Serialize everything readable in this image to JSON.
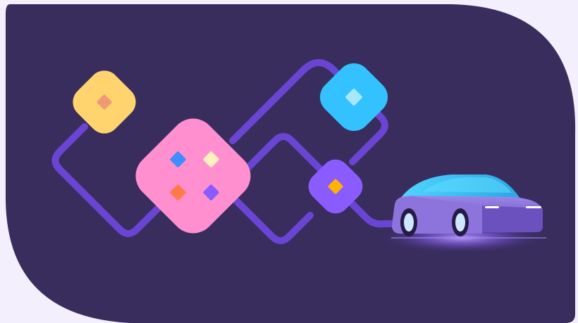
{
  "illustration": {
    "colors": {
      "page_background": "#f3effc",
      "panel_background": "#382d5d",
      "connector_path": "#6a45d4",
      "yellow_tile": "#ffd36d",
      "pink_tile": "#ff8fcf",
      "blue_tile": "#33c2ff",
      "purple_tile": "#8a5cff",
      "car_body": "#7a62c9",
      "car_glass": "#35c7f0",
      "headlight": "#ffffff"
    },
    "tiles": [
      {
        "name": "yellow-tile",
        "accent_dots": [
          "#ef9a74"
        ]
      },
      {
        "name": "pink-tile",
        "accent_dots": [
          "#3f8dff",
          "#fff0c0",
          "#ff7a4a",
          "#8a5cff"
        ]
      },
      {
        "name": "blue-tile",
        "accent_dots": [
          "#a8e8ff"
        ]
      },
      {
        "name": "purple-tile",
        "accent_dots": [
          "#ffb300"
        ]
      }
    ],
    "vehicle": {
      "type": "car-icon"
    }
  }
}
